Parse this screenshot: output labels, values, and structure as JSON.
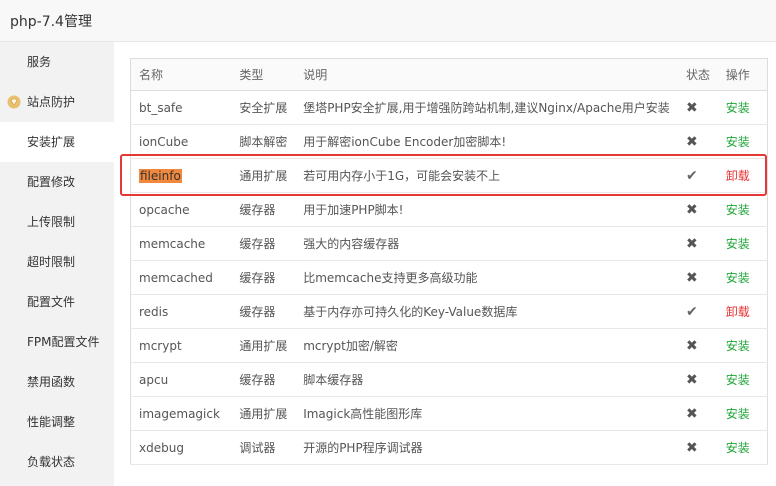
{
  "window": {
    "title": "php-7.4管理"
  },
  "sidebar": {
    "items": [
      {
        "label": "服务",
        "active": false
      },
      {
        "label": "站点防护",
        "active": false,
        "icon": "vip-diamond-icon"
      },
      {
        "label": "安装扩展",
        "active": true
      },
      {
        "label": "配置修改",
        "active": false
      },
      {
        "label": "上传限制",
        "active": false
      },
      {
        "label": "超时限制",
        "active": false
      },
      {
        "label": "配置文件",
        "active": false
      },
      {
        "label": "FPM配置文件",
        "active": false
      },
      {
        "label": "禁用函数",
        "active": false
      },
      {
        "label": "性能调整",
        "active": false
      },
      {
        "label": "负载状态",
        "active": false
      }
    ]
  },
  "table": {
    "headers": {
      "name": "名称",
      "type": "类型",
      "desc": "说明",
      "state": "状态",
      "op": "操作"
    },
    "rows": [
      {
        "name": "bt_safe",
        "type": "安全扩展",
        "desc": "堡塔PHP安全扩展,用于增强防跨站机制,建议Nginx/Apache用户安装",
        "state": "✖",
        "op": "安装"
      },
      {
        "name": "ionCube",
        "type": "脚本解密",
        "desc": "用于解密ionCube Encoder加密脚本!",
        "state": "✖",
        "op": "安装"
      },
      {
        "name": "fileinfo",
        "type": "通用扩展",
        "desc": "若可用内存小于1G，可能会安装不上",
        "state": "✔",
        "op": "卸载"
      },
      {
        "name": "opcache",
        "type": "缓存器",
        "desc": "用于加速PHP脚本!",
        "state": "✖",
        "op": "安装"
      },
      {
        "name": "memcache",
        "type": "缓存器",
        "desc": "强大的内容缓存器",
        "state": "✖",
        "op": "安装"
      },
      {
        "name": "memcached",
        "type": "缓存器",
        "desc": "比memcache支持更多高级功能",
        "state": "✖",
        "op": "安装"
      },
      {
        "name": "redis",
        "type": "缓存器",
        "desc": "基于内存亦可持久化的Key-Value数据库",
        "state": "✔",
        "op": "卸载"
      },
      {
        "name": "mcrypt",
        "type": "通用扩展",
        "desc": "mcrypt加密/解密",
        "state": "✖",
        "op": "安装"
      },
      {
        "name": "apcu",
        "type": "缓存器",
        "desc": "脚本缓存器",
        "state": "✖",
        "op": "安装"
      },
      {
        "name": "imagemagick",
        "type": "通用扩展",
        "desc": "Imagick高性能图形库",
        "state": "✖",
        "op": "安装"
      },
      {
        "name": "xdebug",
        "type": "调试器",
        "desc": "开源的PHP程序调试器",
        "state": "✖",
        "op": "安装"
      }
    ]
  },
  "colors": {
    "install": "#20a53a",
    "uninstall": "#e63232",
    "highlight_box": "#e53935",
    "name_highlight": "#f0883e"
  }
}
